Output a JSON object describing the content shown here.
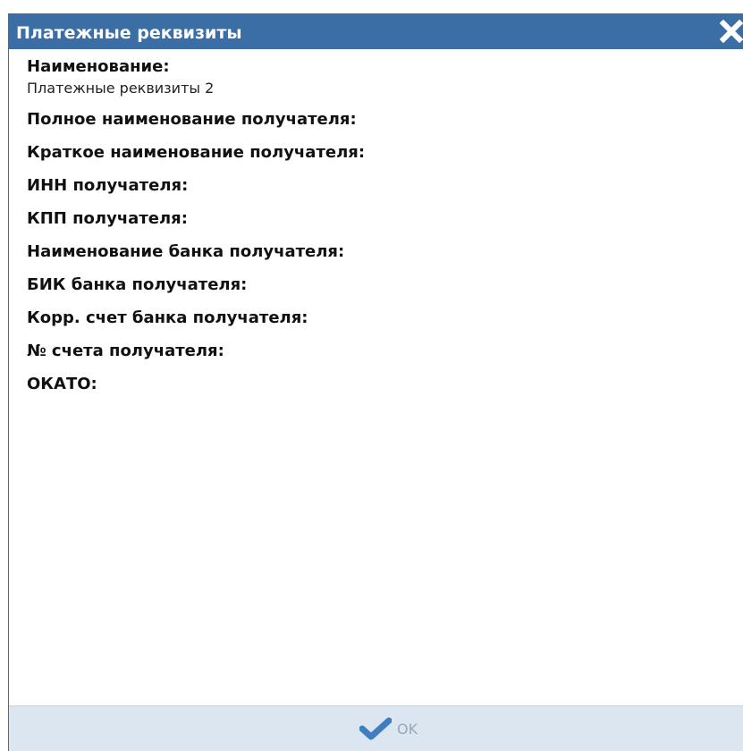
{
  "dialog": {
    "title": "Платежные реквизиты",
    "close_icon": "close-icon"
  },
  "fields": [
    {
      "label": "Наименование:",
      "value": "Платежные реквизиты 2"
    },
    {
      "label": "Полное наименование получателя:",
      "value": ""
    },
    {
      "label": "Краткое наименование получателя:",
      "value": ""
    },
    {
      "label": "ИНН получателя:",
      "value": ""
    },
    {
      "label": "КПП получателя:",
      "value": ""
    },
    {
      "label": "Наименование банка получателя:",
      "value": ""
    },
    {
      "label": "БИК банка получателя:",
      "value": ""
    },
    {
      "label": "Корр. счет банка получателя:",
      "value": ""
    },
    {
      "label": "№ счета получателя:",
      "value": ""
    },
    {
      "label": "ОКАТО:",
      "value": ""
    }
  ],
  "footer": {
    "ok_label": "OK",
    "ok_icon": "checkmark-icon"
  },
  "colors": {
    "titlebar": "#3a6ea5",
    "footer": "#dbe6f1",
    "checkmark": "#3f7fc0"
  }
}
